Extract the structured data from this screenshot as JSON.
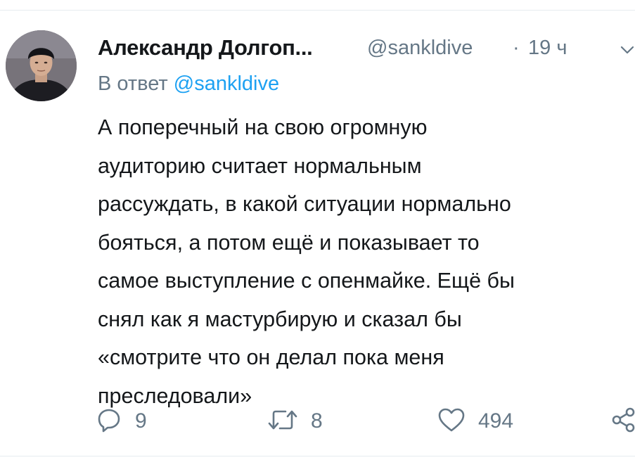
{
  "tweet": {
    "author": {
      "display_name": "Александр Долгоп...",
      "handle": "@sankldive"
    },
    "separator": "·",
    "time": "19 ч",
    "reply_prefix": "В ответ",
    "reply_mention": "@sankldive",
    "text_lines": [
      "А поперечный на свою огромную",
      "аудиторию считает нормальным",
      "рассуждать, в какой ситуации нормально",
      "бояться, а потом ещё и показывает то",
      "самое выступление с опенмайке. Ещё бы",
      "снял как я мастурбирую и сказал бы",
      "«смотрите что он делал пока меня",
      "преследовали»"
    ],
    "actions": {
      "reply_count": "9",
      "retweet_count": "8",
      "like_count": "494"
    },
    "icons": [
      "chevron-down-icon",
      "reply-icon",
      "retweet-icon",
      "like-icon",
      "share-icon"
    ],
    "colors": {
      "text": "#14171a",
      "secondary": "#657786",
      "link": "#1da1f2",
      "divider": "#e6ecf0"
    }
  }
}
